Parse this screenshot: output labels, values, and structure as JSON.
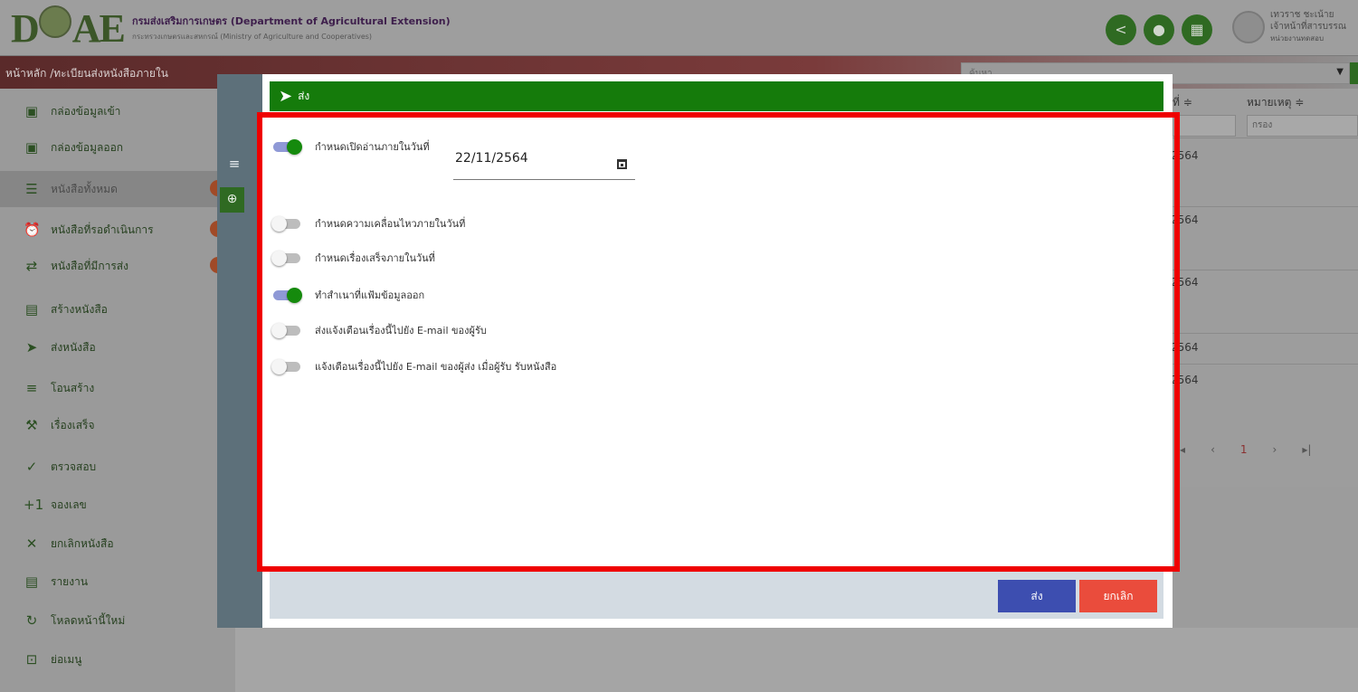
{
  "header": {
    "logo_text": "DOAE",
    "org_name_th": "กรมส่งเสริมการเกษตร",
    "org_name_en": "(Department of Agricultural Extension)",
    "org_sub": "กระทรวงเกษตรและสหกรณ์ (Ministry of Agriculture and Cooperatives)",
    "user_name": "เทวราช ชะเน้าย",
    "user_role": "เจ้าหน้าที่สารบรรณ",
    "user_unit": "หน่วยงานทดสอบ"
  },
  "breadcrumb": "หน้าหลัก /ทะเบียนส่งหนังสือภายใน",
  "search": {
    "placeholder": "ค้นหา"
  },
  "sidebar": {
    "items": [
      {
        "label": "กล่องข้อมูลเข้า",
        "icon": "inbox-icon"
      },
      {
        "label": "กล่องข้อมูลออก",
        "icon": "outbox-icon"
      },
      {
        "label": "หนังสือทั้งหมด",
        "icon": "list-icon"
      },
      {
        "label": "หนังสือที่รอดำเนินการ",
        "icon": "alarm-icon"
      },
      {
        "label": "หนังสือที่มีการส่ง",
        "icon": "swap-icon"
      },
      {
        "label": "สร้างหนังสือ",
        "icon": "file-add-icon"
      },
      {
        "label": "ส่งหนังสือ",
        "icon": "send-icon"
      },
      {
        "label": "โอนสร้าง",
        "icon": "transfer-icon"
      },
      {
        "label": "เรื่องเสร็จ",
        "icon": "gavel-icon"
      },
      {
        "label": "ตรวจสอบ",
        "icon": "check-icon"
      },
      {
        "label": "จองเลข",
        "icon": "plus-one-icon"
      },
      {
        "label": "ยกเลิกหนังสือ",
        "icon": "close-icon"
      },
      {
        "label": "รายงาน",
        "icon": "report-icon"
      },
      {
        "label": "โหลดหน้านี้ใหม่",
        "icon": "reload-icon"
      },
      {
        "label": "ย่อเมนู",
        "icon": "collapse-icon"
      }
    ]
  },
  "table": {
    "col_date": "ที่ ≑",
    "col_note": "หมายเหตุ ≑",
    "filter_placeholder": "กรอง",
    "rows": [
      "2564",
      "2564",
      "2564",
      "2564",
      "2564"
    ],
    "pager": {
      "first": "|◂",
      "prev": "‹",
      "current": "1",
      "next": "›",
      "last": "▸|"
    }
  },
  "modal": {
    "title": "ส่ง",
    "options": [
      {
        "label": "กำหนดเปิดอ่านภายในวันที่",
        "on": true
      },
      {
        "label": "กำหนดความเคลื่อนไหวภายในวันที่",
        "on": false
      },
      {
        "label": "กำหนดเรื่องเสร็จภายในวันที่",
        "on": false
      },
      {
        "label": "ทำสำเนาที่แฟ้มข้อมูลออก",
        "on": true
      },
      {
        "label": "ส่งแจ้งเตือนเรื่องนี้ไปยัง E-mail ของผู้รับ",
        "on": false
      },
      {
        "label": "แจ้งเตือนเรื่องนี้ไปยัง E-mail ของผู้ส่ง เมื่อผู้รับ รับหนังสือ",
        "on": false
      }
    ],
    "date_value": "22/11/2564",
    "send_label": "ส่ง",
    "cancel_label": "ยกเลิก"
  },
  "colors": {
    "primary_green": "#157b0b",
    "highlight_frame": "#ef0000",
    "send_button": "#3d4eb0",
    "cancel_button": "#ea4c3c"
  }
}
